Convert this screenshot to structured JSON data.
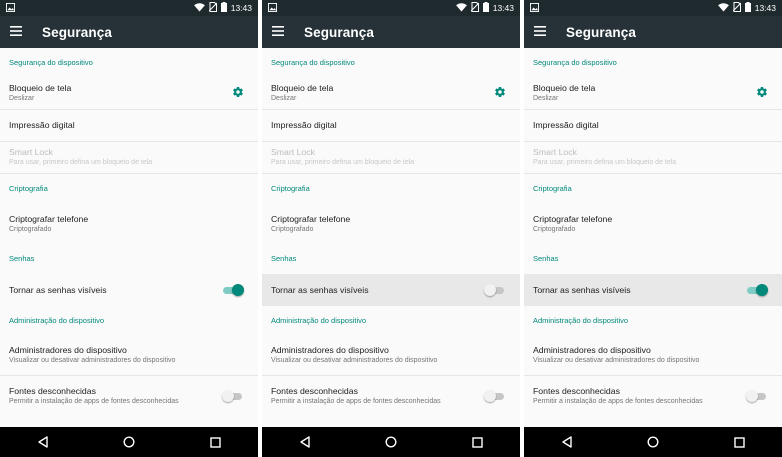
{
  "accent_color": "#00897b",
  "screens": [
    {
      "status": {
        "time": "13:43"
      },
      "appbar": {
        "title": "Segurança"
      },
      "sections": {
        "device_security": "Segurança do dispositivo",
        "screen_lock_label": "Bloqueio de tela",
        "screen_lock_sub": "Deslizar",
        "fingerprint_label": "Impressão digital",
        "smart_lock_label": "Smart Lock",
        "smart_lock_sub": "Para usar, primeiro defina um bloqueio de tela",
        "crypto": "Criptografia",
        "encrypt_label": "Criptografar telefone",
        "encrypt_sub": "Criptografado",
        "passwords": "Senhas",
        "show_passwords_label": "Tornar as senhas visíveis",
        "show_passwords_on": true,
        "device_admin": "Administração do dispositivo",
        "admins_label": "Administradores do dispositivo",
        "admins_sub": "Visualizar ou desativar administradores do dispositivo",
        "unknown_label": "Fontes desconhecidas",
        "unknown_sub": "Permitir a instalação de apps de fontes desconhecidas",
        "unknown_on": false
      }
    },
    {
      "status": {
        "time": "13:43"
      },
      "appbar": {
        "title": "Segurança"
      },
      "sections": {
        "device_security": "Segurança do dispositivo",
        "screen_lock_label": "Bloqueio de tela",
        "screen_lock_sub": "Deslizar",
        "fingerprint_label": "Impressão digital",
        "smart_lock_label": "Smart Lock",
        "smart_lock_sub": "Para usar, primeiro defina um bloqueio de tela",
        "crypto": "Criptografia",
        "encrypt_label": "Criptografar telefone",
        "encrypt_sub": "Criptografado",
        "passwords": "Senhas",
        "show_passwords_label": "Tornar as senhas visíveis",
        "show_passwords_on": false,
        "device_admin": "Administração do dispositivo",
        "admins_label": "Administradores do dispositivo",
        "admins_sub": "Visualizar ou desativar administradores do dispositivo",
        "unknown_label": "Fontes desconhecidas",
        "unknown_sub": "Permitir a instalação de apps de fontes desconhecidas",
        "unknown_on": false
      }
    },
    {
      "status": {
        "time": "13:43"
      },
      "appbar": {
        "title": "Segurança"
      },
      "sections": {
        "device_security": "Segurança do dispositivo",
        "screen_lock_label": "Bloqueio de tela",
        "screen_lock_sub": "Deslizar",
        "fingerprint_label": "Impressão digital",
        "smart_lock_label": "Smart Lock",
        "smart_lock_sub": "Para usar, primeiro defina um bloqueio de tela",
        "crypto": "Criptografia",
        "encrypt_label": "Criptografar telefone",
        "encrypt_sub": "Criptografado",
        "passwords": "Senhas",
        "show_passwords_label": "Tornar as senhas visíveis",
        "show_passwords_on": true,
        "device_admin": "Administração do dispositivo",
        "admins_label": "Administradores do dispositivo",
        "admins_sub": "Visualizar ou desativar administradores do dispositivo",
        "unknown_label": "Fontes desconhecidas",
        "unknown_sub": "Permitir a instalação de apps de fontes desconhecidas",
        "unknown_on": false
      }
    }
  ]
}
